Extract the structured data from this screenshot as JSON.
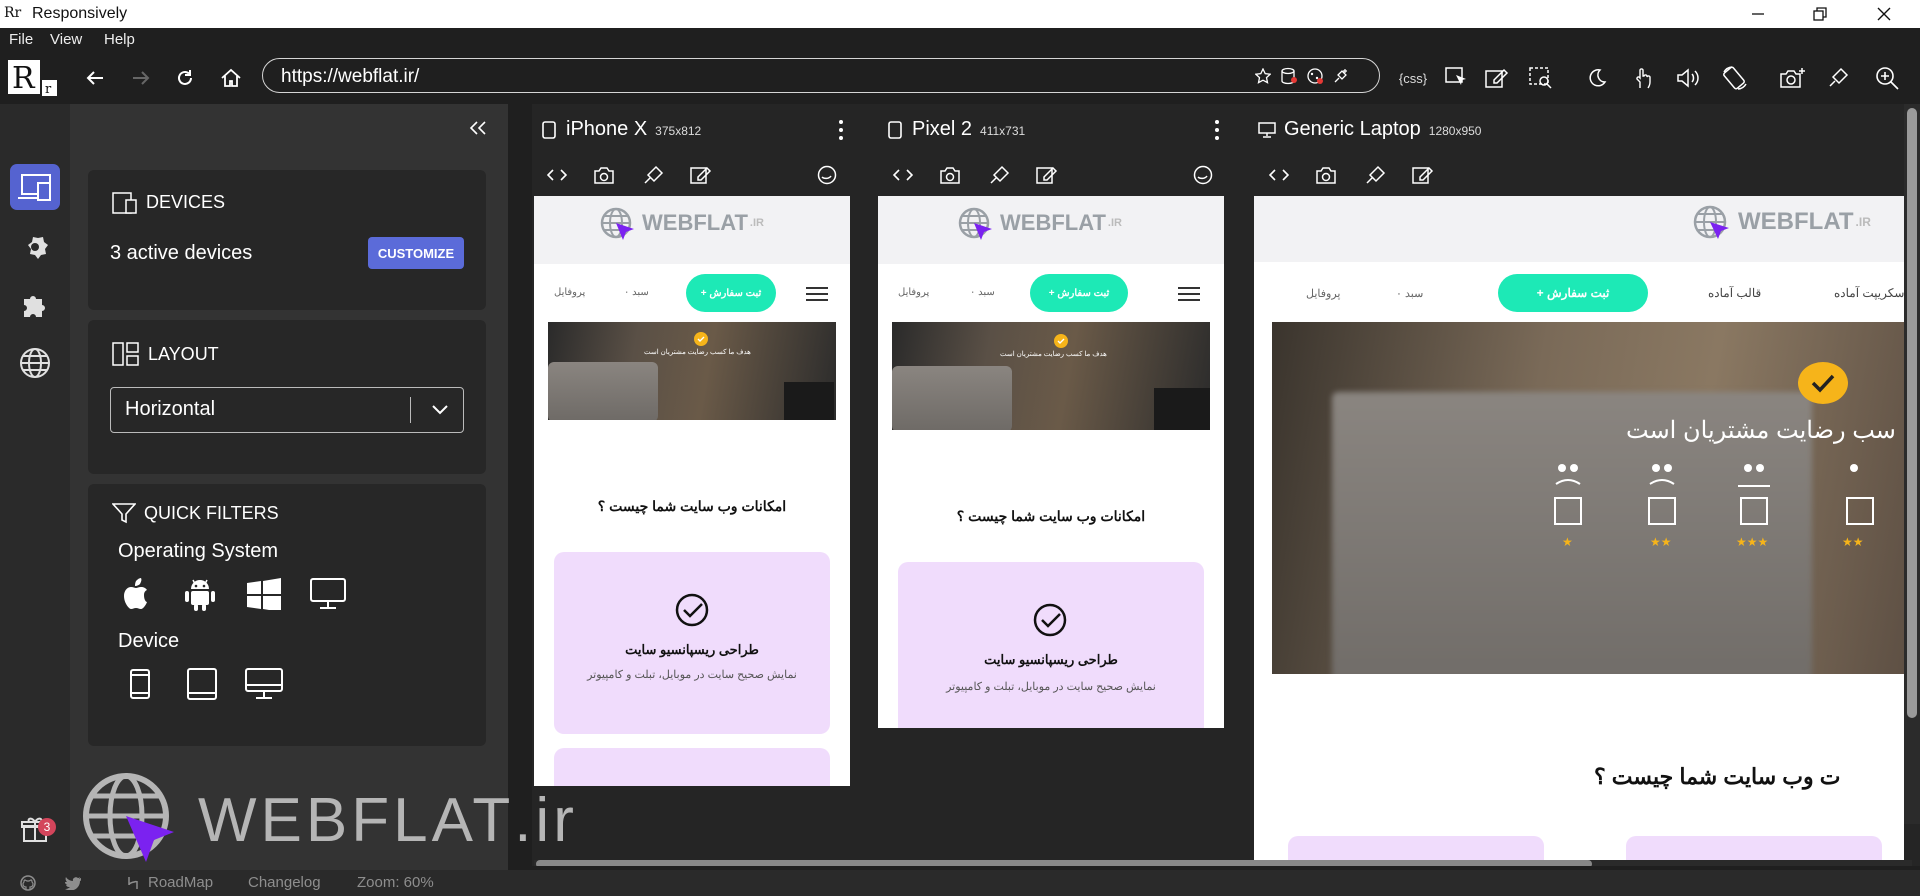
{
  "window": {
    "title": "Responsively",
    "logo_text": "Rr"
  },
  "menu": [
    "File",
    "View",
    "Help"
  ],
  "address": {
    "url": "https://webflat.ir/"
  },
  "toolbar_icons": [
    "back-icon",
    "forward-icon",
    "reload-icon",
    "home-icon",
    "bookmark-star-icon",
    "clear-storage-icon",
    "cookie-icon",
    "pin-icon",
    "css-icon",
    "inspect-icon",
    "edit-icon",
    "screenshot-region-icon",
    "dark-mode-icon",
    "touch-icon",
    "mute-icon",
    "rotate-icon",
    "camera-icon",
    "designer-tool-icon",
    "zoom-icon"
  ],
  "css_label": "{css}",
  "sidebar": {
    "devices": {
      "heading": "DEVICES",
      "active": "3 active devices",
      "customize": "CUSTOMIZE"
    },
    "layout": {
      "heading": "LAYOUT",
      "value": "Horizontal"
    },
    "filters": {
      "heading": "QUICK FILTERS",
      "os_label": "Operating System",
      "device_label": "Device"
    }
  },
  "devices": [
    {
      "name": "iPhone X",
      "res": "375x812"
    },
    {
      "name": "Pixel 2",
      "res": "411x731"
    },
    {
      "name": "Generic Laptop",
      "res": "1280x950"
    }
  ],
  "site": {
    "logo_main": "WEBFLAT",
    "logo_sub": ".IR",
    "order_btn": "+ ثبت سفارش",
    "cart": "سبد ۰",
    "profile": "پروفایل",
    "nav_templates": "قالب آماده",
    "nav_scripts": "اسکریپت آماده",
    "hero_small": "هدف ما کسب رضایت مشتریان است",
    "hero_large": "سب رضایت مشتریان است",
    "question_full": "امکانات وب سایت شما چیست ؟",
    "question_cut": "ت وب سایت شما چیست ؟",
    "card_title": "طراحی ریسپانسیو سایت",
    "card_desc_1": "نمایش صحیح سایت در موبایل، تبلت و کامپیوتر",
    "card_desc_2": "نمایش صحیح سایت در موبایل، تبلت و کامپیوتر"
  },
  "watermark": {
    "main": "WEBFLAT",
    "sub": ".ir"
  },
  "gift_badge": "3",
  "status": {
    "roadmap": "RoadMap",
    "changelog": "Changelog",
    "zoom": "Zoom: 60%"
  }
}
